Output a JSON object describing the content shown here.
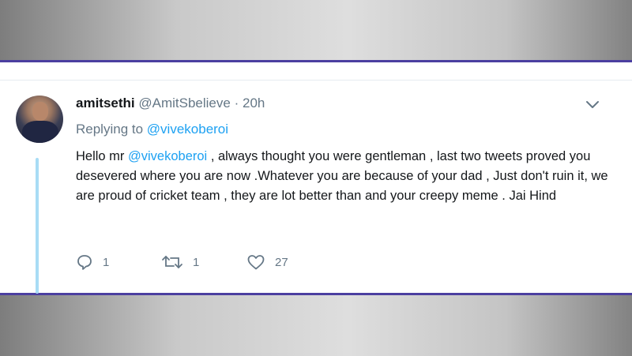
{
  "tweet": {
    "display_name": "amitsethi",
    "handle": "@AmitSbelieve",
    "separator": "·",
    "time": "20h",
    "replying_prefix": "Replying to",
    "replying_to": "@vivekoberoi",
    "text_part1": "Hello mr ",
    "text_mention": "@vivekoberoi",
    "text_part2": "  , always thought you were gentleman , last two tweets proved you desevered where you are now .Whatever you are because of your dad , Just don't ruin it, we are proud of cricket team , they are lot better than and your creepy meme . Jai Hind"
  },
  "actions": {
    "reply_icon": "reply-icon",
    "reply_count": "1",
    "retweet_icon": "retweet-icon",
    "retweet_count": "1",
    "like_icon": "heart-icon",
    "like_count": "27"
  },
  "colors": {
    "frame_border": "#4b3fa0",
    "mention": "#1da1f2",
    "thread_line": "#a8dcf5",
    "muted": "#657786"
  }
}
